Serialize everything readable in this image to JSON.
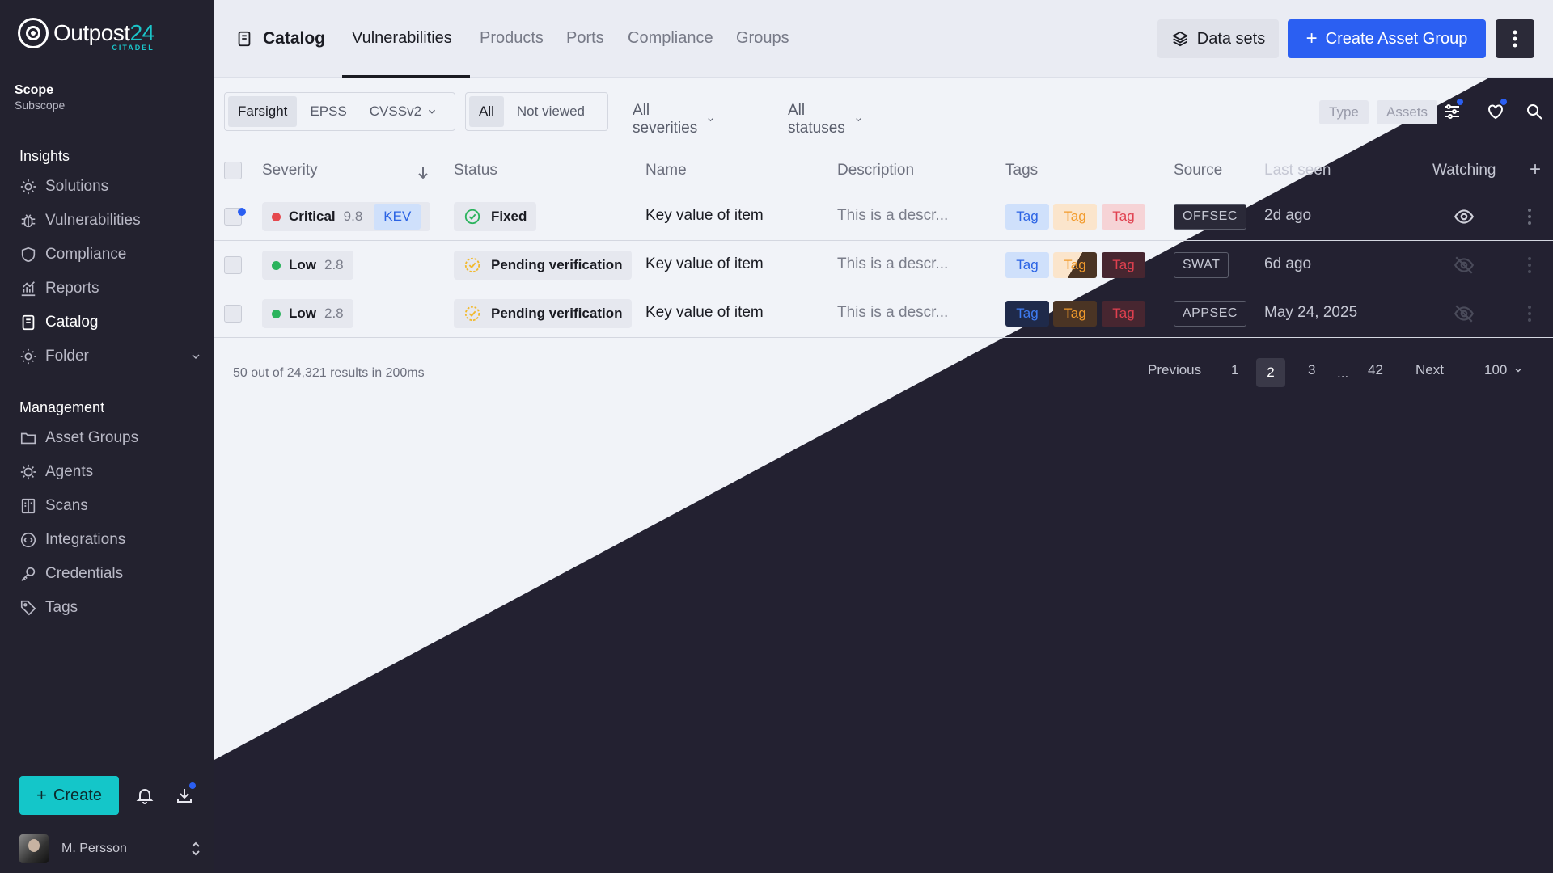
{
  "brand": {
    "name": "Outpost",
    "number": "24",
    "sub": "CITADEL"
  },
  "scope": {
    "title": "Scope",
    "subtitle": "Subscope"
  },
  "sidebar": {
    "insights_title": "Insights",
    "insights": [
      {
        "label": "Solutions",
        "icon": "bulb-icon"
      },
      {
        "label": "Vulnerabilities",
        "icon": "bug-icon"
      },
      {
        "label": "Compliance",
        "icon": "shield-icon"
      },
      {
        "label": "Reports",
        "icon": "chart-icon"
      },
      {
        "label": "Catalog",
        "icon": "book-icon",
        "active": true
      },
      {
        "label": "Folder",
        "icon": "sun-icon"
      }
    ],
    "management_title": "Management",
    "management": [
      {
        "label": "Asset Groups",
        "icon": "folder-icon"
      },
      {
        "label": "Agents",
        "icon": "agent-icon"
      },
      {
        "label": "Scans",
        "icon": "scan-icon"
      },
      {
        "label": "Integrations",
        "icon": "integration-icon"
      },
      {
        "label": "Credentials",
        "icon": "key-icon"
      },
      {
        "label": "Tags",
        "icon": "tag-icon"
      }
    ],
    "create_label": "Create",
    "user_name": "M. Persson"
  },
  "header": {
    "title": "Catalog",
    "tabs": [
      "Vulnerabilities",
      "Products",
      "Ports",
      "Compliance",
      "Groups"
    ],
    "active_tab": "Vulnerabilities",
    "datasets_label": "Data sets",
    "create_group_label": "Create Asset Group"
  },
  "filters": {
    "scoring": [
      "Farsight",
      "EPSS",
      "CVSSv2"
    ],
    "scoring_selected": "Farsight",
    "view": [
      "All",
      "Not viewed"
    ],
    "view_selected": "All",
    "severity_dropdown": "All severities",
    "status_dropdown": "All statuses",
    "type_chip": "Type",
    "assets_chip": "Assets"
  },
  "table": {
    "columns": [
      "Severity",
      "Status",
      "Name",
      "Description",
      "Tags",
      "Source",
      "Last seen",
      "Watching"
    ],
    "rows": [
      {
        "severity": "Critical",
        "score": "9.8",
        "kev": "KEV",
        "status": "Fixed",
        "name": "Key value of item",
        "description": "This is a descr...",
        "tags": [
          "Tag",
          "Tag",
          "Tag"
        ],
        "source": "OFFSEC",
        "last_seen": "2d ago",
        "watching": true,
        "unread": true
      },
      {
        "severity": "Low",
        "score": "2.8",
        "status": "Pending verification",
        "name": "Key value of item",
        "description": "This is a descr...",
        "tags": [
          "Tag",
          "Tag",
          "Tag"
        ],
        "source": "SWAT",
        "last_seen": "6d ago",
        "watching": false
      },
      {
        "severity": "Low",
        "score": "2.8",
        "status": "Pending verification",
        "name": "Key value of item",
        "description": "This is a descr...",
        "tags": [
          "Tag",
          "Tag",
          "Tag"
        ],
        "source": "APPSEC",
        "last_seen": "May 24, 2025",
        "watching": false
      }
    ]
  },
  "footer": {
    "results": "50 out of 24,321 results in 200ms",
    "previous": "Previous",
    "pages": [
      "1",
      "2",
      "3",
      "...",
      "42"
    ],
    "current_page": "2",
    "next": "Next",
    "page_size": "100"
  },
  "colors": {
    "sidebar_bg": "#23222f",
    "dark_bg": "#232131",
    "light_bg": "#f1f3f8",
    "primary": "#2b5ff2",
    "accent": "#14c6c9",
    "critical": "#e5484d",
    "low": "#2bb35d"
  }
}
